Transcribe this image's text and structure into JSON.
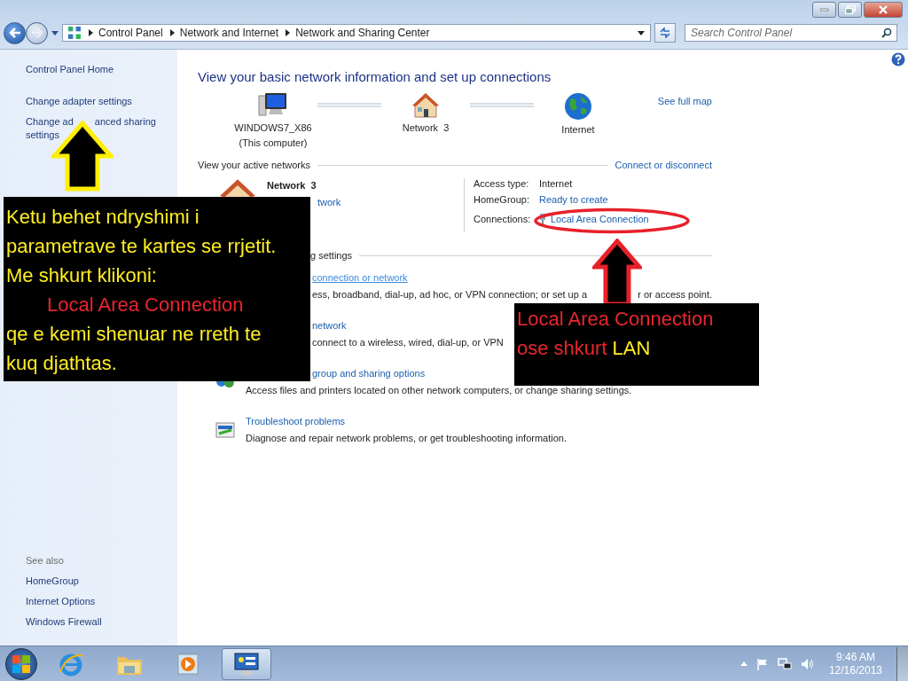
{
  "address_bar": {
    "breadcrumbs": [
      "Control Panel",
      "Network and Internet",
      "Network and Sharing Center"
    ]
  },
  "search": {
    "placeholder": "Search Control Panel"
  },
  "sidebar": {
    "items": [
      {
        "parts": [
          "Control Panel Home"
        ]
      },
      {
        "parts": [
          "Change adapter settings"
        ]
      },
      {
        "parts": [
          "Change ad",
          "anced sharing",
          "settings"
        ]
      }
    ],
    "see_also": {
      "title": "See also",
      "items": [
        "HomeGroup",
        "Internet Options",
        "Windows Firewall"
      ]
    }
  },
  "main": {
    "heading": "View your basic network information and set up connections",
    "map": {
      "nodes": [
        {
          "kind": "computer",
          "label": "WINDOWS7_X86",
          "sublabel": "(This computer)"
        },
        {
          "kind": "network",
          "label": "Network  3"
        },
        {
          "kind": "internet",
          "label": "Internet"
        }
      ],
      "link": "See full map"
    },
    "active_networks": {
      "title": "View your active networks",
      "link": "Connect or disconnect",
      "network_name": "Network  3",
      "network_type": "twork",
      "details": [
        {
          "label": "Access type:",
          "value": "Internet",
          "kind": "text"
        },
        {
          "label": "HomeGroup:",
          "value": "Ready to create",
          "kind": "link"
        },
        {
          "label": "Connections:",
          "value": "Local Area Connection",
          "kind": "connection"
        }
      ]
    },
    "settings_title": "g settings",
    "tasks": [
      {
        "title": "connection or network",
        "desc": [
          "ess, broadband, dial-up, ad hoc, or VPN connection; or set up a",
          "r or access point."
        ],
        "hover": true
      },
      {
        "title": "network",
        "desc": [
          "connect to a wireless, wired, dial-up, or VPN"
        ],
        "hover": false
      },
      {
        "title": "group and sharing options",
        "desc": [
          "Access files and printers located on other network computers, or change sharing settings."
        ],
        "hover": false
      },
      {
        "title": "Troubleshoot problems",
        "desc": [
          "Diagnose and repair network problems, or get troubleshooting information."
        ],
        "hover": false
      }
    ]
  },
  "callouts": [
    {
      "lines": [
        [
          {
            "text": "Ketu behet ndryshimi i",
            "kind": "yellow"
          }
        ],
        [
          {
            "text": "parametrave te kartes se rrjetit.",
            "kind": "yellow"
          }
        ],
        [
          {
            "text": "Me shkurt klikoni:",
            "kind": "yellow"
          }
        ],
        [
          {
            "text": "Local Area Connection",
            "kind": "red"
          }
        ],
        [
          {
            "text": "qe e kemi shenuar ne rreth te",
            "kind": "yellow"
          }
        ],
        [
          {
            "text": "kuq djathtas.",
            "kind": "yellow"
          }
        ]
      ]
    },
    {
      "lines": [
        [
          {
            "text": "Local Area Connection",
            "kind": "red"
          }
        ],
        [
          {
            "text": "ose shkurt",
            "kind": "red"
          },
          {
            "text": "LAN",
            "kind": "yellow"
          }
        ]
      ]
    }
  ],
  "taskbar": {
    "apps": [
      {
        "kind": "ie",
        "selected": false
      },
      {
        "kind": "explorer",
        "selected": false
      },
      {
        "kind": "media",
        "selected": false
      },
      {
        "kind": "control",
        "selected": true
      }
    ],
    "time": "9:46 AM",
    "date": "12/16/2013"
  }
}
